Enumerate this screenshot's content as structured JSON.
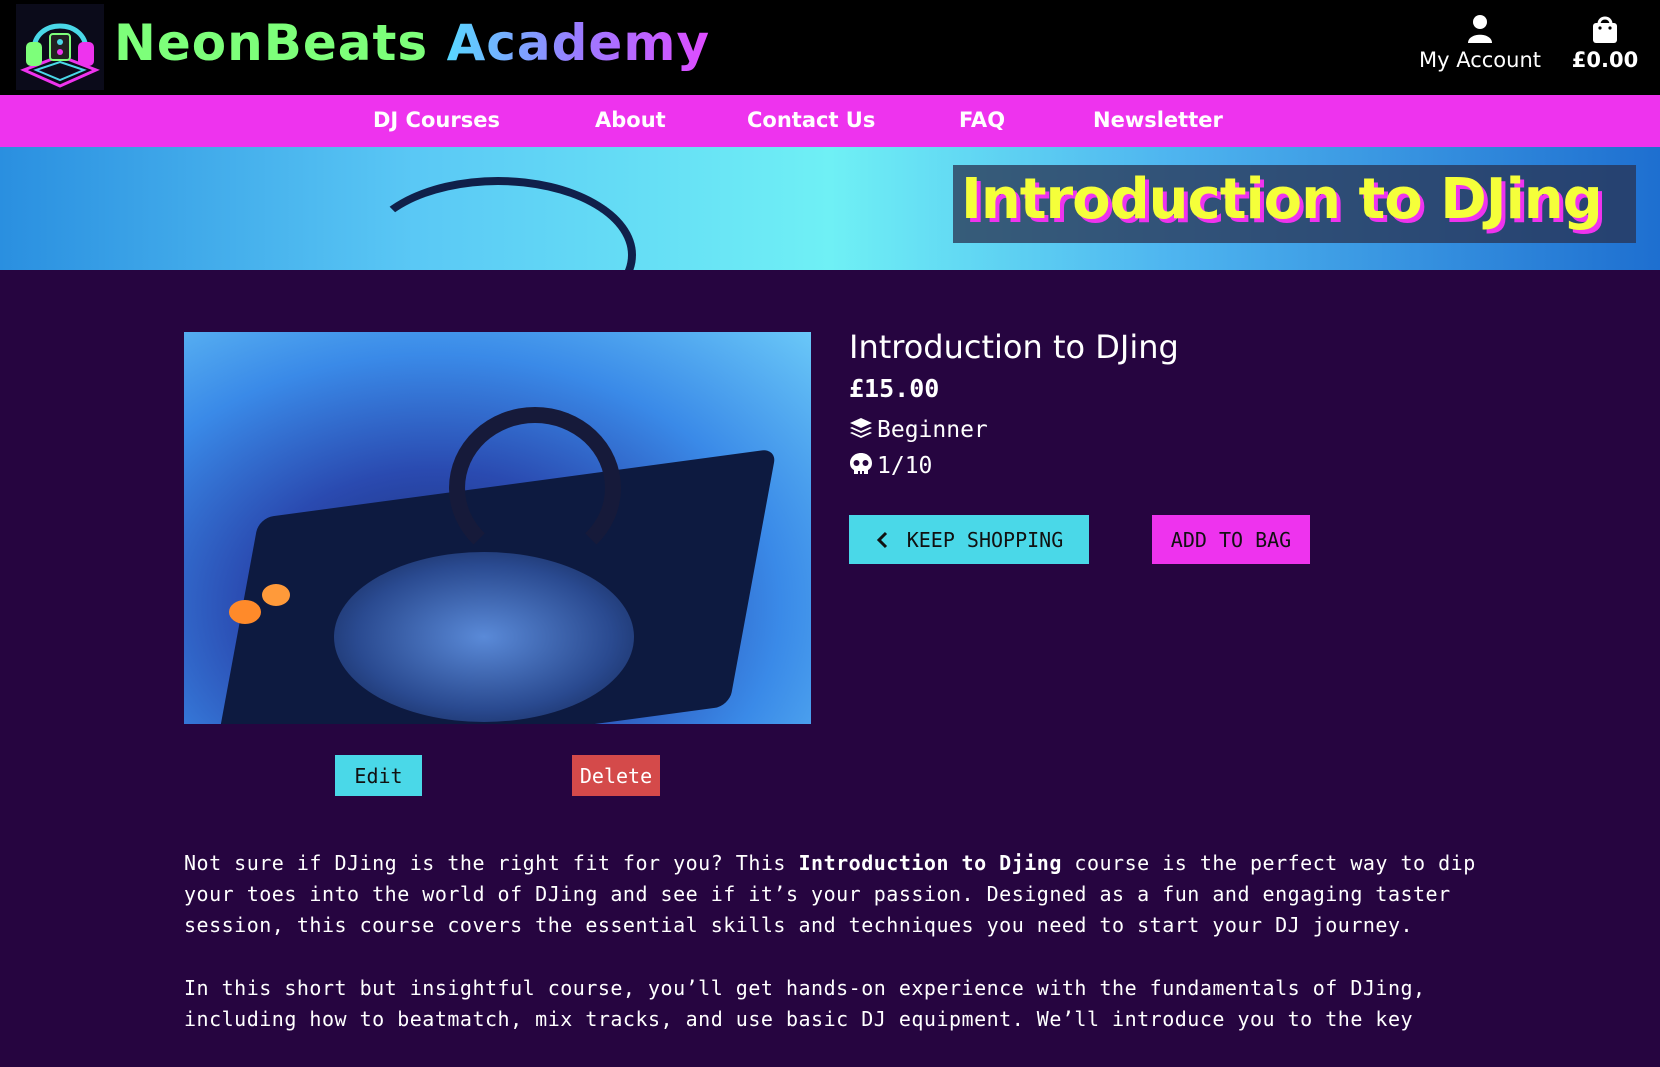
{
  "header": {
    "brand_part1": "NeonBeats",
    "brand_part2": "Academy",
    "account_label": "My Account",
    "bag_total": "£0.00",
    "icons": [
      "dj-headphones-logo",
      "user-icon",
      "shopping-bag-icon"
    ]
  },
  "nav": {
    "items": [
      {
        "label": "DJ Courses"
      },
      {
        "label": "About"
      },
      {
        "label": "Contact Us"
      },
      {
        "label": "FAQ"
      },
      {
        "label": "Newsletter"
      }
    ]
  },
  "hero": {
    "title": "Introduction to DJing"
  },
  "product": {
    "title": "Introduction to DJing",
    "price": "£15.00",
    "level": "Beginner",
    "difficulty": "1/10",
    "keep_shopping_label": "KEEP SHOPPING",
    "add_to_bag_label": "ADD TO BAG",
    "edit_label": "Edit",
    "delete_label": "Delete",
    "icons": [
      "layers-icon",
      "skull-icon",
      "chevron-left-icon"
    ]
  },
  "description": {
    "p1_before": "Not sure if DJing is the right fit for you? This ",
    "p1_bold": "Introduction to Djing",
    "p1_after": " course is the perfect way to dip your toes into the world of DJing and see if it’s your passion. Designed as a fun and engaging taster session, this course covers the essential skills and techniques you need to start your DJ journey.",
    "p2": "In this short but insightful course, you’ll get hands-on experience with the fundamentals of DJing, including how to beatmatch, mix tracks, and use basic DJ equipment. We’ll introduce you to the key"
  },
  "colors": {
    "background": "#260540",
    "nav": "#ee33ee",
    "cyan_button": "#4ad8e8",
    "delete_button": "#d44a4a",
    "hero_title": "#f5ff3a"
  }
}
